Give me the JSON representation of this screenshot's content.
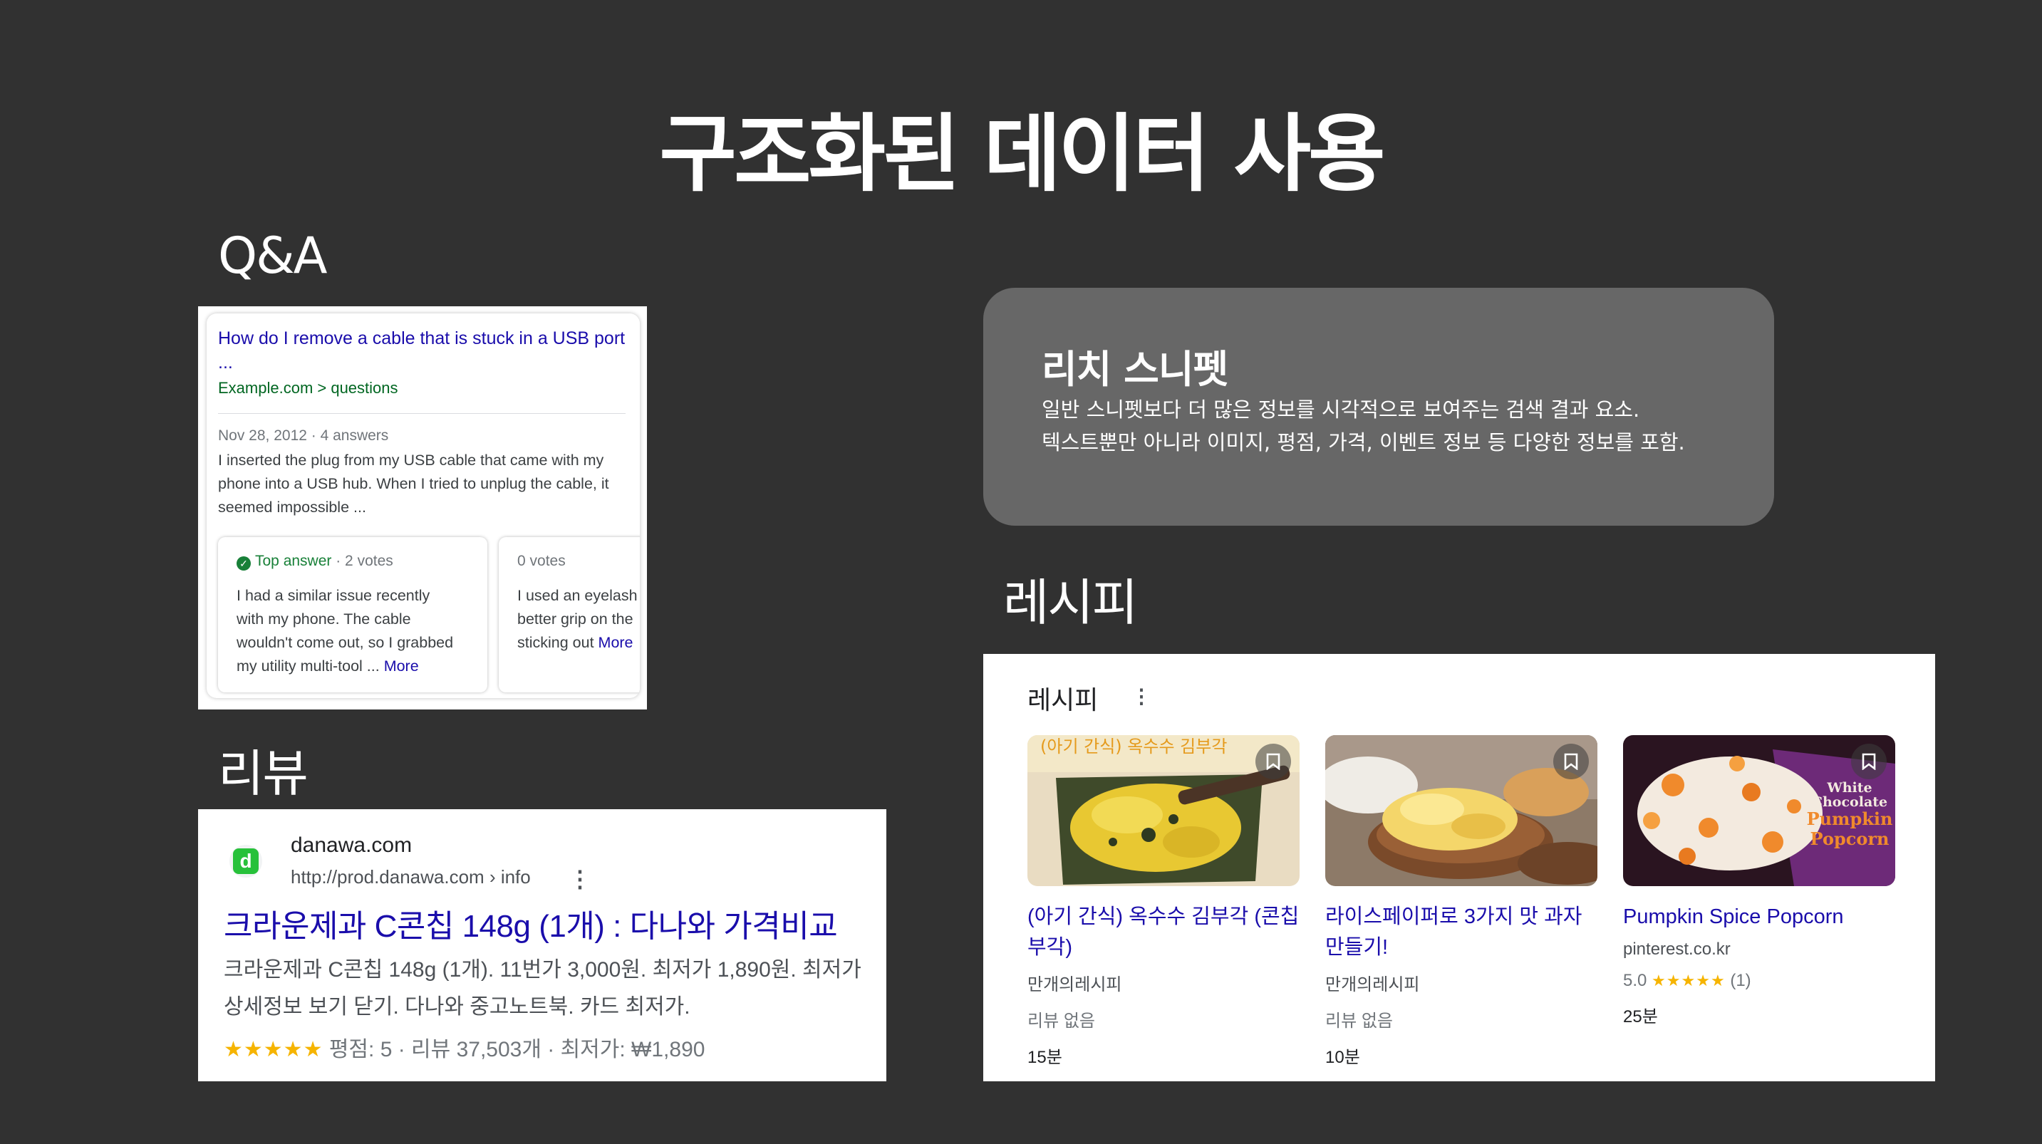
{
  "slide_title": "구조화된 데이터 사용",
  "sections": {
    "qa": "Q&A",
    "review": "리뷰",
    "recipe": "레시피"
  },
  "qa_snippet": {
    "title": "How do I remove a cable that is stuck in a USB port ...",
    "breadcrumb": "Example.com > questions",
    "meta": "Nov 28, 2012 · 4 answers",
    "body": "I inserted the plug from my USB cable that came with my phone into a USB hub. When I tried to unplug the cable, it seemed impossible ...",
    "answers": [
      {
        "badge": "Top answer",
        "votes": " · 2 votes",
        "text": "I had a similar issue recently\nwith my phone. The cable\nwouldn't come out, so I grabbed\nmy utility multi-tool ... ",
        "more": "More"
      },
      {
        "votes": "0 votes",
        "text": "I used an eyelash\nbetter grip on the\nsticking out ",
        "more": "More"
      }
    ]
  },
  "rich_snippet": {
    "heading": "리치 스니펫",
    "line1": "일반 스니펫보다 더 많은 정보를 시각적으로 보여주는 검색 결과 요소.",
    "line2": "텍스트뿐만 아니라 이미지, 평점, 가격, 이벤트 정보 등 다양한 정보를 포함."
  },
  "review_snippet": {
    "favicon_letter": "d",
    "site": "danawa.com",
    "url": "http://prod.danawa.com › info",
    "title": "크라운제과 C콘칩 148g (1개) : 다나와 가격비교",
    "desc_line1": "크라운제과 C콘칩 148g (1개). 11번가 3,000원. 최저가 1,890원. 최저가",
    "desc_line2": "상세정보 보기 닫기. 다나와 중고노트북. 카드 최저가.",
    "stars": "★★★★★",
    "rating_text": " 평점: 5 · 리뷰 37,503개 · 최저가: ₩1,890"
  },
  "recipe_snippet": {
    "heading": "레시피",
    "items": [
      {
        "name": "(아기 간식) 옥수수 김부각 (콘칩 부각)",
        "source": "만개의레시피",
        "rating": "리뷰 없음",
        "time": "15분",
        "thumb_text": "(아기 간식) 옥수수 김부각"
      },
      {
        "name": "라이스페이퍼로 3가지 맛 과자 만들기!",
        "source": "만개의레시피",
        "rating": "리뷰 없음",
        "time": "10분"
      },
      {
        "name": "Pumpkin Spice Popcorn",
        "source": "pinterest.co.kr",
        "rating_value": "5.0",
        "stars": "★★★★★",
        "rating_count": "(1)",
        "time": "25분",
        "thumb_text": [
          "White",
          "Chocolate",
          "Pumpkin",
          "Popcorn"
        ]
      }
    ]
  },
  "colors": {
    "background": "#313131",
    "rich_box": "#676767",
    "link_blue": "#1a0dab",
    "star": "#f6b400",
    "accept_green": "#188038",
    "danawa_green": "#27c13a"
  }
}
